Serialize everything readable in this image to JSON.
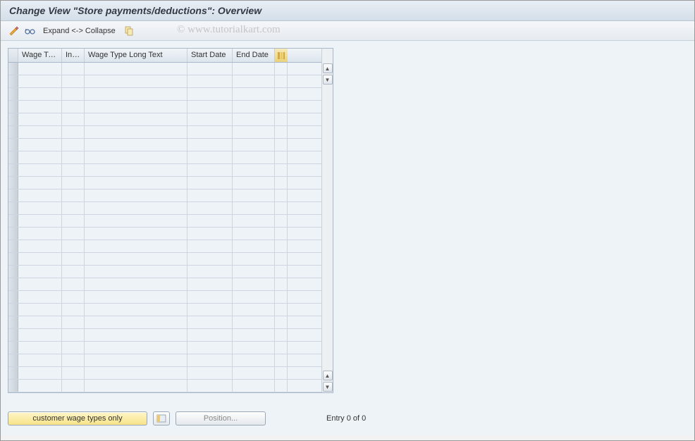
{
  "title": "Change View \"Store payments/deductions\": Overview",
  "toolbar": {
    "expand_collapse_label": "Expand <-> Collapse"
  },
  "watermark": "© www.tutorialkart.com",
  "table": {
    "columns": [
      "Wage Ty...",
      "Inf...",
      "Wage Type Long Text",
      "Start Date",
      "End Date"
    ],
    "row_count": 26
  },
  "buttons": {
    "customer_wage": "customer wage types only",
    "position": "Position..."
  },
  "status": "Entry 0 of 0"
}
